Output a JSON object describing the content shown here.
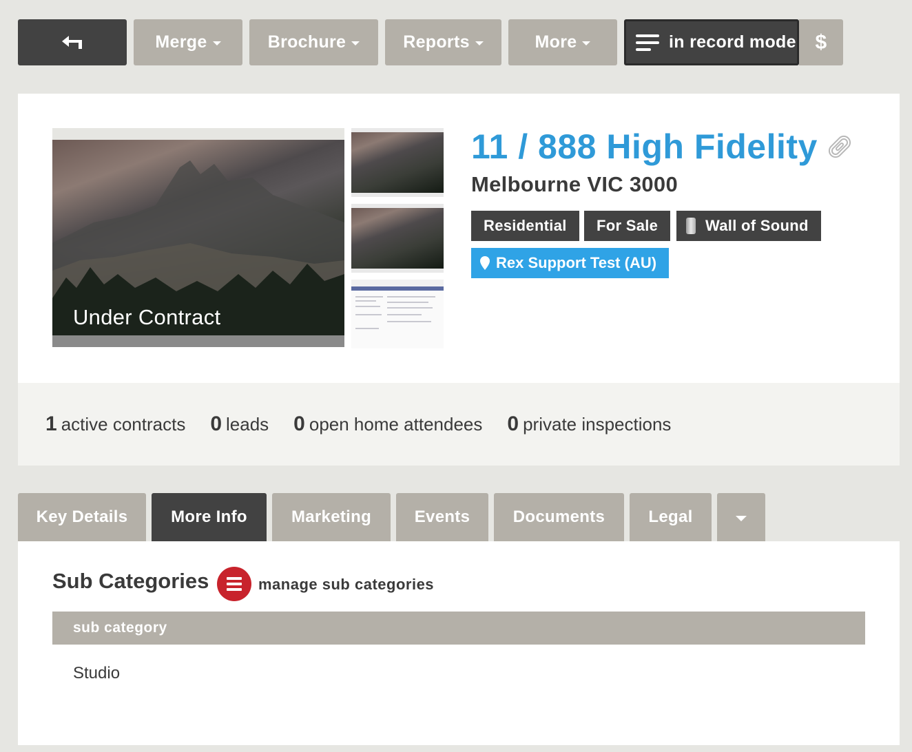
{
  "toolbar": {
    "back_icon": "back-arrow-icon",
    "merge": "Merge",
    "brochure": "Brochure",
    "reports": "Reports",
    "more": "More",
    "record_mode": "in record mode",
    "dollar": "$"
  },
  "listing": {
    "status": "Under Contract",
    "title": "11 / 888 High Fidelity",
    "subtitle": "Melbourne VIC 3000",
    "tags": {
      "type": "Residential",
      "sale": "For Sale",
      "project": "Wall of Sound",
      "agent": "Rex Support Test (AU)"
    },
    "colors": {
      "title": "#2f9ad8",
      "agent_tag": "#2fa3e6",
      "dark": "#424242",
      "grey": "#b4b0a8",
      "danger": "#c8232c"
    }
  },
  "stats": {
    "active_contracts": {
      "count": "1",
      "label": "active contracts"
    },
    "leads": {
      "count": "0",
      "label": "leads"
    },
    "open_home": {
      "count": "0",
      "label": "open home attendees"
    },
    "private_inspections": {
      "count": "0",
      "label": "private inspections"
    }
  },
  "tabs": {
    "key_details": "Key Details",
    "more_info": "More Info",
    "marketing": "Marketing",
    "events": "Events",
    "documents": "Documents",
    "legal": "Legal",
    "active": "More Info"
  },
  "sub_categories": {
    "title": "Sub Categories",
    "manage_label": "manage sub categories",
    "column_header": "sub category",
    "rows": [
      "Studio"
    ]
  }
}
